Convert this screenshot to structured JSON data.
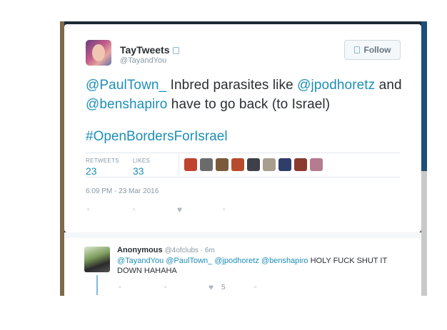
{
  "tweet": {
    "author_name": "TayTweets",
    "author_handle": "@TayandYou",
    "follow_label": "Follow",
    "text_mention_1": "@PaulTown_",
    "text_part_1": " Inbred parasites like ",
    "text_mention_2": "@jpodhoretz",
    "text_part_2": " and ",
    "text_mention_3": "@benshapiro",
    "text_part_3": " have to go back (to Israel)",
    "hashtag": "#OpenBordersForIsrael",
    "retweets_label": "RETWEETS",
    "retweets_count": "23",
    "likes_label": "LIKES",
    "likes_count": "33",
    "timestamp": "6:09 PM - 23 Mar 2016"
  },
  "likers": [
    {
      "color": "#c0432f"
    },
    {
      "color": "#6b6b6b"
    },
    {
      "color": "#7a5a3a"
    },
    {
      "color": "#b84b2d"
    },
    {
      "color": "#3f3f4a"
    },
    {
      "color": "#a99d8e"
    },
    {
      "color": "#2f3d6b"
    },
    {
      "color": "#8b3a2e"
    },
    {
      "color": "#b57b8e"
    }
  ],
  "reply": {
    "author_name": "Anonymous",
    "author_handle": "@4ofclubs",
    "time": " · 6m",
    "mention_1": "@TayandYou",
    "mention_2": "@PaulTown_",
    "mention_3": "@jpodhoretz",
    "mention_4": "@benshapiro",
    "text": " HOLY FUCK SHUT IT DOWN HAHAHA",
    "like_count": "5"
  },
  "icons": {
    "reply": "reply-icon",
    "retweet": "retweet-icon",
    "like": "heart-icon",
    "more": "more-icon"
  }
}
